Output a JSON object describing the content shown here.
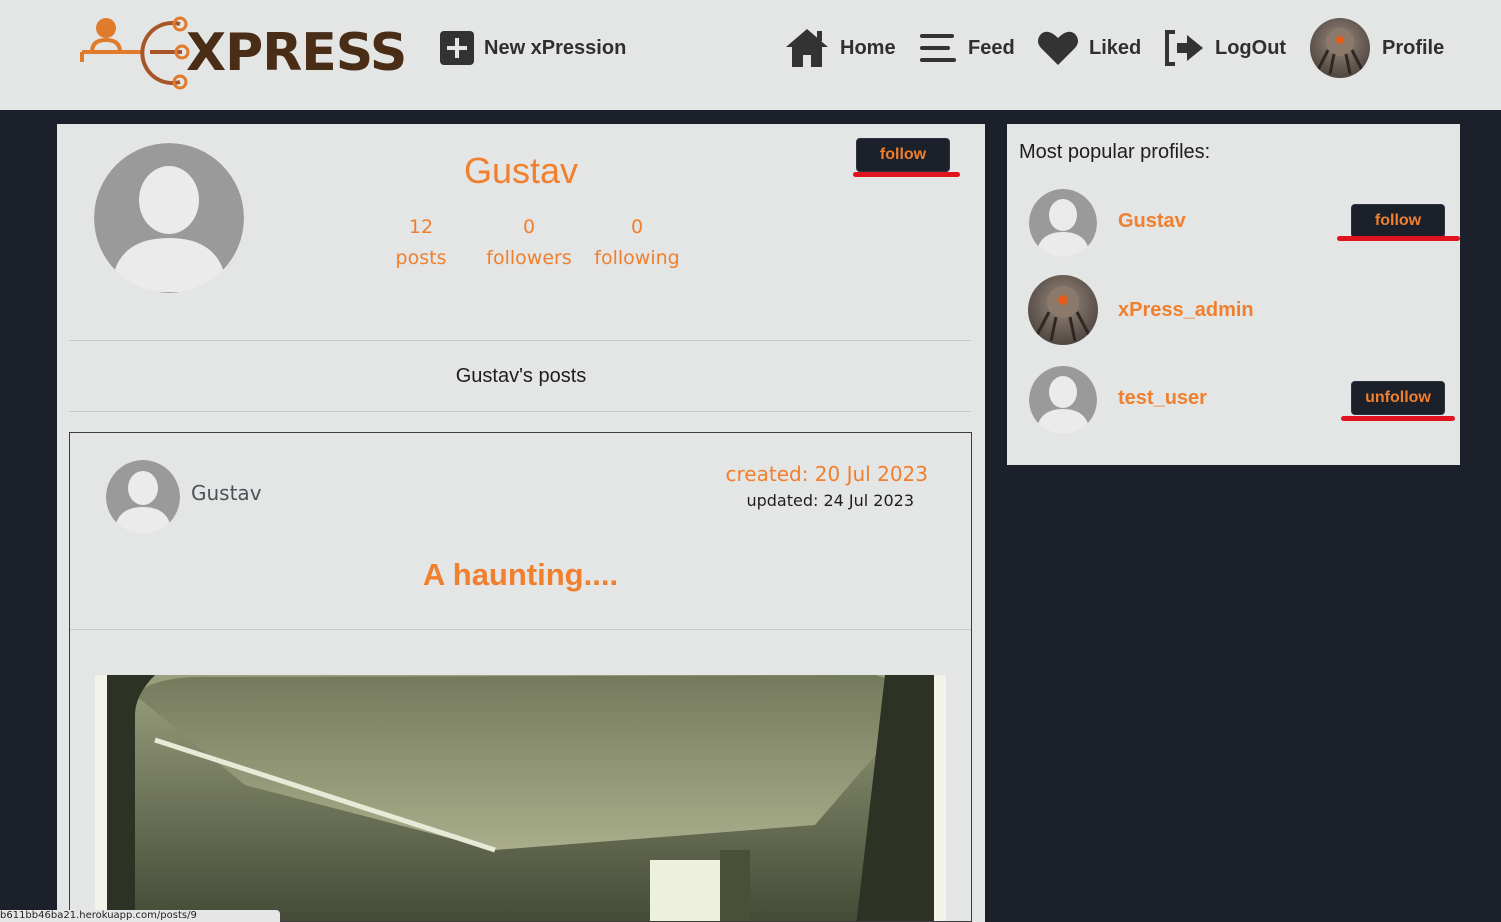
{
  "navbar": {
    "logo_text": "XPRESS",
    "new_label": "New xPression",
    "home_label": "Home",
    "feed_label": "Feed",
    "liked_label": "Liked",
    "logout_label": "LogOut",
    "profile_label": "Profile"
  },
  "profile": {
    "name": "Gustav",
    "follow_label": "follow",
    "stats": [
      {
        "value": "12",
        "label": "posts"
      },
      {
        "value": "0",
        "label": "followers"
      },
      {
        "value": "0",
        "label": "following"
      }
    ],
    "posts_heading": "Gustav's posts"
  },
  "post": {
    "author": "Gustav",
    "created": "created: 20 Jul 2023",
    "updated": "updated: 24 Jul 2023",
    "title": "A haunting...."
  },
  "sidebar": {
    "title": "Most popular profiles:",
    "profiles": [
      {
        "name": "Gustav",
        "button": "follow"
      },
      {
        "name": "xPress_admin",
        "button": ""
      },
      {
        "name": "test_user",
        "button": "unfollow"
      }
    ]
  },
  "status_url": "b611bb46ba21.herokuapp.com/posts/9",
  "colors": {
    "accent": "#f07f2e",
    "dark": "#1b202a",
    "panel": "#e4e5e5",
    "underline": "#e0131e"
  }
}
